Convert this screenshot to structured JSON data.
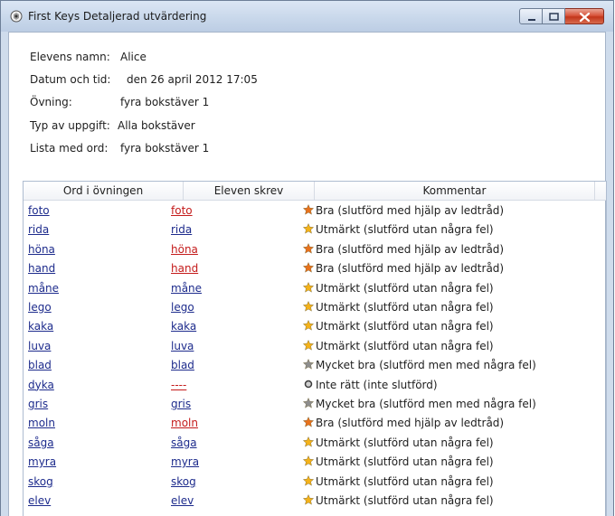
{
  "window": {
    "title": "First Keys Detaljerad utvärdering"
  },
  "info": {
    "rows": [
      {
        "label": "Elevens namn:",
        "value": "Alice"
      },
      {
        "label": "Datum och tid:",
        "value": "den 26 april 2012 17:05"
      },
      {
        "label": "Övning:",
        "value": "fyra bokstäver 1"
      },
      {
        "label": "Typ av uppgift:",
        "value": "Alla bokstäver"
      },
      {
        "label": "Lista med ord:",
        "value": "fyra bokstäver 1"
      }
    ]
  },
  "table": {
    "columns": [
      "Ord i övningen",
      "Eleven skrev",
      "Kommentar"
    ],
    "rows": [
      {
        "expected": "foto",
        "typed": "foto",
        "typed_style": "wrong",
        "icon": "orange-star-icon",
        "comment": "Bra (slutförd med hjälp av ledtråd)"
      },
      {
        "expected": "rida",
        "typed": "rida",
        "typed_style": "ok",
        "icon": "gold-star-icon",
        "comment": "Utmärkt (slutförd utan några fel)"
      },
      {
        "expected": "höna",
        "typed": "höna",
        "typed_style": "wrong",
        "icon": "orange-star-icon",
        "comment": "Bra (slutförd med hjälp av ledtråd)"
      },
      {
        "expected": "hand",
        "typed": "hand",
        "typed_style": "wrong",
        "icon": "orange-star-icon",
        "comment": "Bra (slutförd med hjälp av ledtråd)"
      },
      {
        "expected": "måne",
        "typed": "måne",
        "typed_style": "ok",
        "icon": "gold-star-icon",
        "comment": "Utmärkt (slutförd utan några fel)"
      },
      {
        "expected": "lego",
        "typed": "lego",
        "typed_style": "ok",
        "icon": "gold-star-icon",
        "comment": "Utmärkt (slutförd utan några fel)"
      },
      {
        "expected": "kaka",
        "typed": "kaka",
        "typed_style": "ok",
        "icon": "gold-star-icon",
        "comment": "Utmärkt (slutförd utan några fel)"
      },
      {
        "expected": "luva",
        "typed": "luva",
        "typed_style": "ok",
        "icon": "gold-star-icon",
        "comment": "Utmärkt (slutförd utan några fel)"
      },
      {
        "expected": "blad",
        "typed": "blad",
        "typed_style": "ok",
        "icon": "silver-star-icon",
        "comment": "Mycket bra (slutförd men med några fel)"
      },
      {
        "expected": "dyka",
        "typed": "----",
        "typed_style": "dash",
        "icon": "dot-icon",
        "comment": "Inte rätt (inte slutförd)"
      },
      {
        "expected": "gris",
        "typed": "gris",
        "typed_style": "ok",
        "icon": "silver-star-icon",
        "comment": "Mycket bra (slutförd men med några fel)"
      },
      {
        "expected": "moln",
        "typed": "moln",
        "typed_style": "wrong",
        "icon": "orange-star-icon",
        "comment": "Bra (slutförd med hjälp av ledtråd)"
      },
      {
        "expected": "såga",
        "typed": "såga",
        "typed_style": "ok",
        "icon": "gold-star-icon",
        "comment": "Utmärkt (slutförd utan några fel)"
      },
      {
        "expected": "myra",
        "typed": "myra",
        "typed_style": "ok",
        "icon": "gold-star-icon",
        "comment": "Utmärkt (slutförd utan några fel)"
      },
      {
        "expected": "skog",
        "typed": "skog",
        "typed_style": "ok",
        "icon": "gold-star-icon",
        "comment": "Utmärkt (slutförd utan några fel)"
      },
      {
        "expected": "elev",
        "typed": "elev",
        "typed_style": "ok",
        "icon": "gold-star-icon",
        "comment": "Utmärkt (slutförd utan några fel)"
      }
    ]
  },
  "colors": {
    "link": "#1d2b8c",
    "wrong": "#c41b1b",
    "gold_star": "#f4b21a",
    "orange_star": "#e8721c",
    "silver_star": "#8e8e8e"
  }
}
